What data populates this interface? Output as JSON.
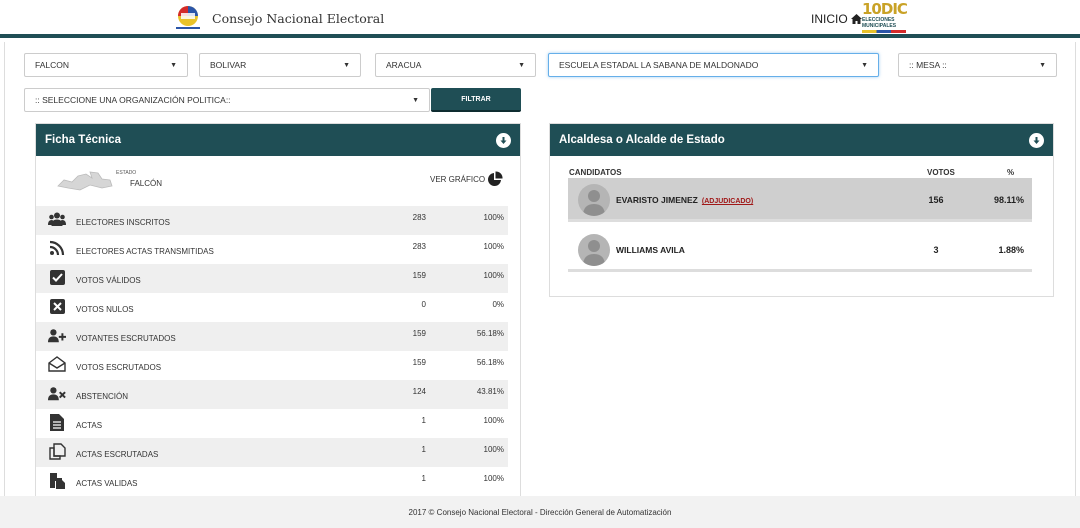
{
  "header": {
    "brand": "Consejo Nacional Electoral",
    "inicio_label": "INICIO",
    "logo_10dic": "10DIC",
    "logo_sub": "ELECCIONES MUNICIPALES",
    "brand_color": "#1f4e55"
  },
  "filters": {
    "estado": "FALCON",
    "municipio": "BOLIVAR",
    "parroquia": "ARACUA",
    "centro": "ESCUELA ESTADAL LA SABANA DE MALDONADO",
    "mesa": ":: MESA ::",
    "organizacion": ":: SELECCIONE UNA ORGANIZACIÓN POLITICA::",
    "filtrar_label": "FILTRAR"
  },
  "ficha": {
    "title": "Ficha Técnica",
    "estado_small": "ESTADO",
    "estado_name": "FALCÓN",
    "ver_grafico": "VER GRÁFICO",
    "rows": [
      {
        "label": "ELECTORES INSCRITOS",
        "value": "283",
        "pct": "100%",
        "icon": "users-icon"
      },
      {
        "label": "ELECTORES ACTAS TRANSMITIDAS",
        "value": "283",
        "pct": "100%",
        "icon": "rss-icon"
      },
      {
        "label": "VOTOS VÁLIDOS",
        "value": "159",
        "pct": "100%",
        "icon": "checkbox-icon"
      },
      {
        "label": "VOTOS NULOS",
        "value": "0",
        "pct": "0%",
        "icon": "x-box-icon"
      },
      {
        "label": "VOTANTES ESCRUTADOS",
        "value": "159",
        "pct": "56.18%",
        "icon": "user-plus-icon"
      },
      {
        "label": "VOTOS ESCRUTADOS",
        "value": "159",
        "pct": "56.18%",
        "icon": "envelope-open-icon"
      },
      {
        "label": "ABSTENCIÓN",
        "value": "124",
        "pct": "43.81%",
        "icon": "user-x-icon"
      },
      {
        "label": "ACTAS",
        "value": "1",
        "pct": "100%",
        "icon": "file-icon"
      },
      {
        "label": "ACTAS ESCRUTADAS",
        "value": "1",
        "pct": "100%",
        "icon": "copy-icon"
      },
      {
        "label": "ACTAS VALIDAS",
        "value": "1",
        "pct": "100%",
        "icon": "file-copy-icon"
      }
    ]
  },
  "alcalde": {
    "title": "Alcaldesa o Alcalde de Estado",
    "col_candidatos": "CANDIDATOS",
    "col_votos": "VOTOS",
    "col_pct": "%",
    "candidates": [
      {
        "name": "EVARISTO JIMENEZ",
        "tag": "(ADJUDICADO)",
        "votes": "156",
        "pct": "98.11%"
      },
      {
        "name": "WILLIAMS AVILA",
        "tag": "",
        "votes": "3",
        "pct": "1.88%"
      }
    ]
  },
  "footer": {
    "text": "2017 © Consejo Nacional Electoral - Dirección General de Automatización"
  }
}
